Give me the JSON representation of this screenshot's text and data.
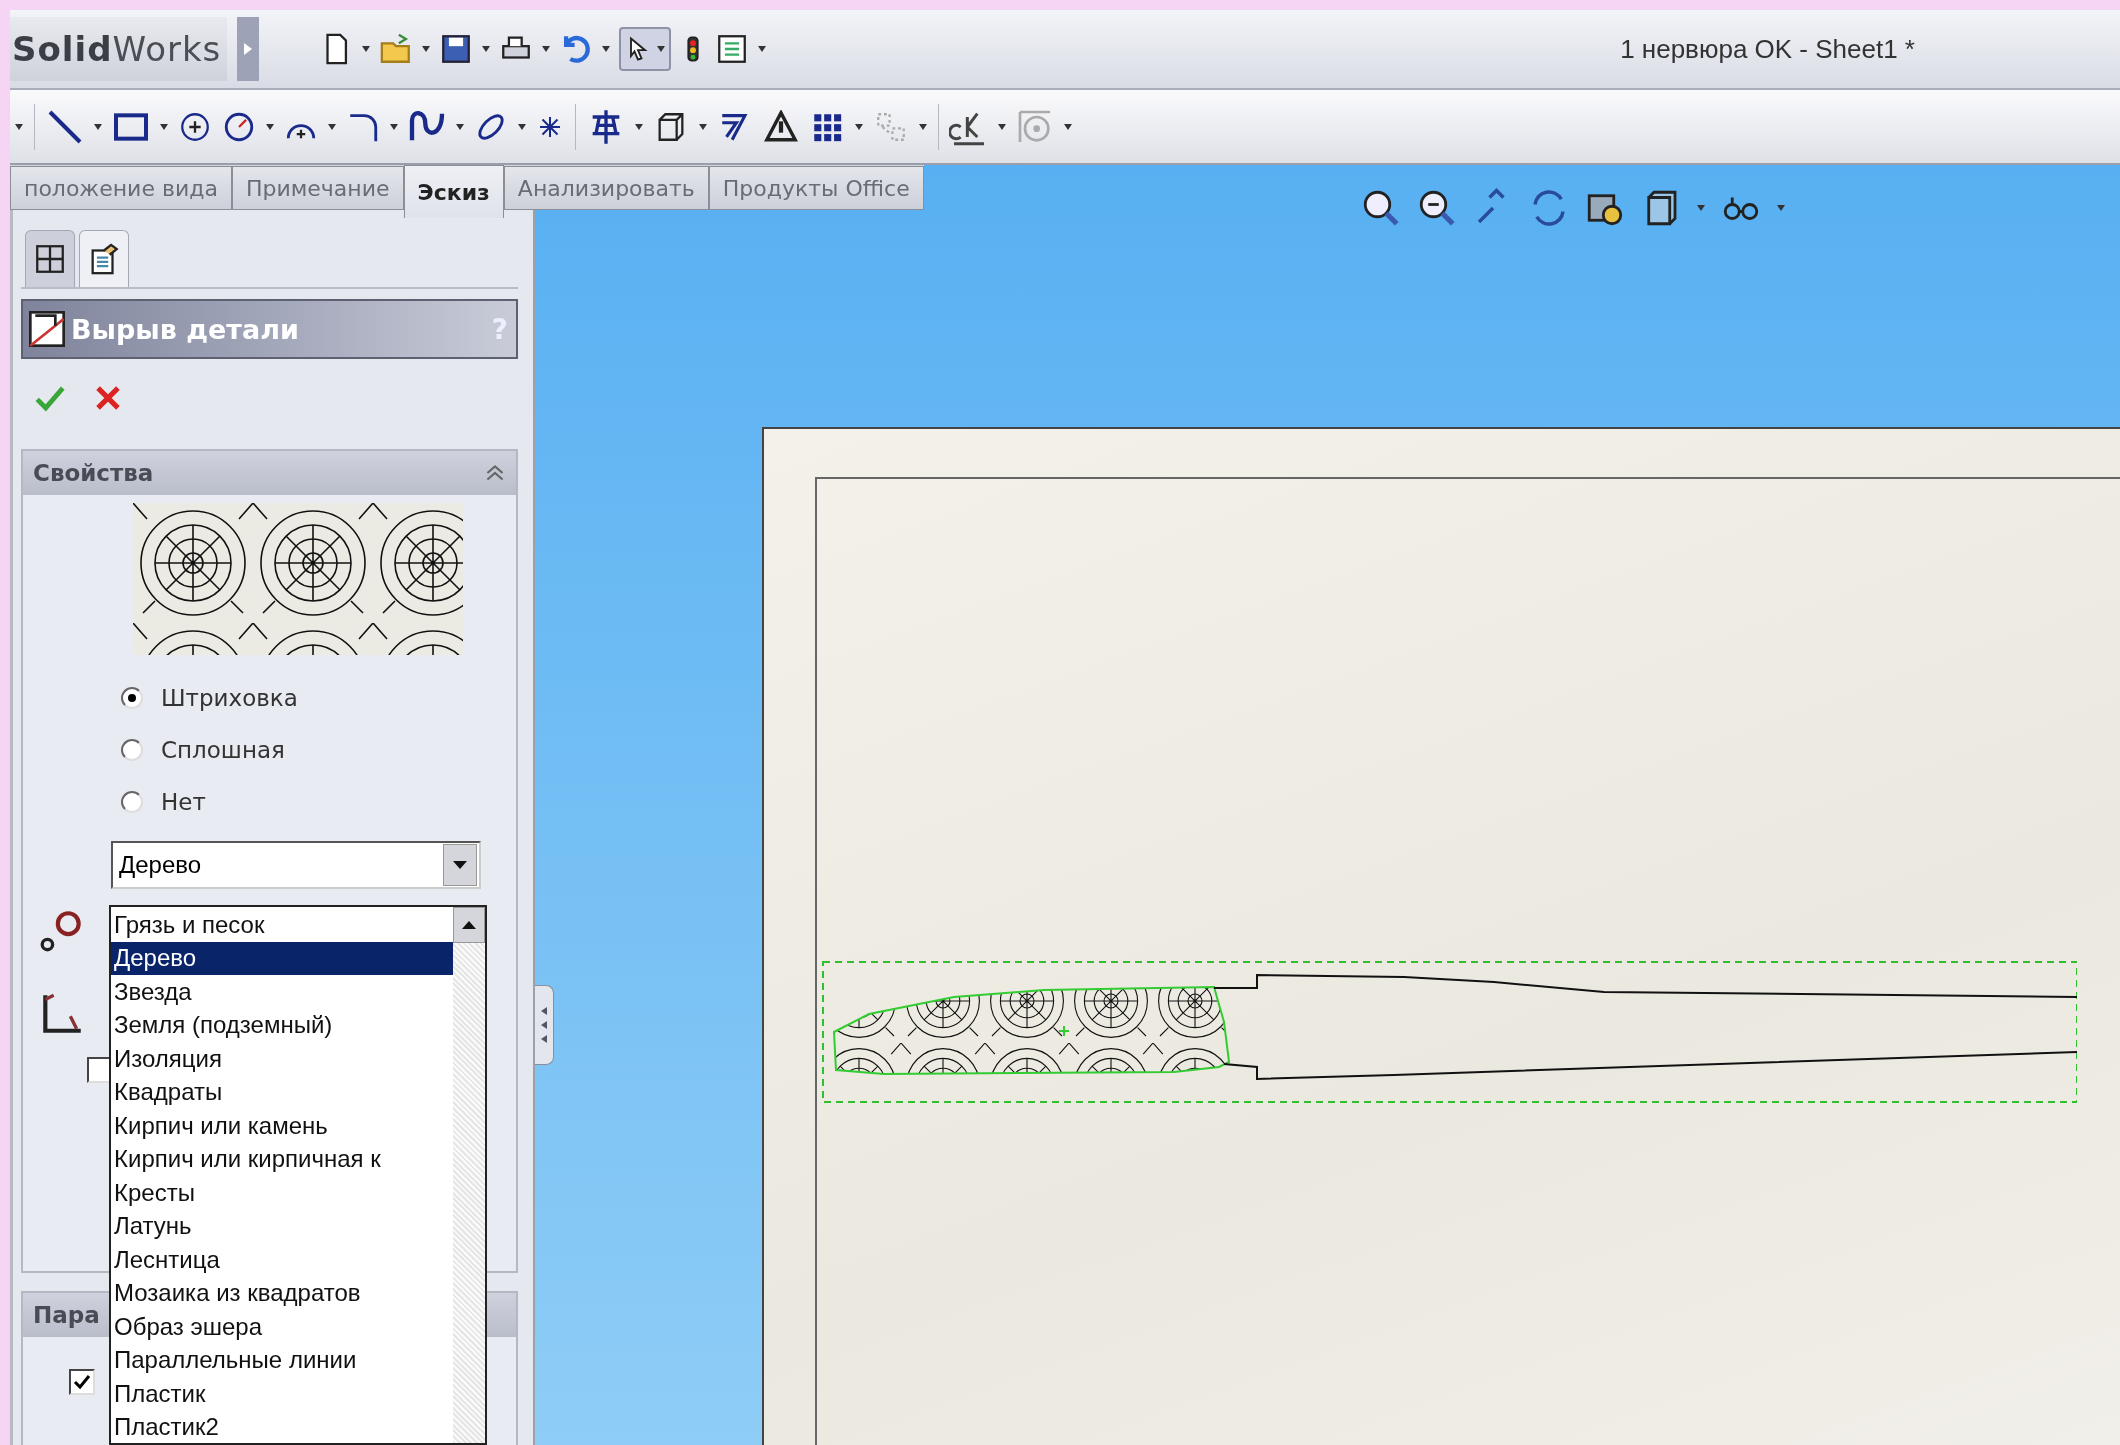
{
  "title_bar": {
    "logo": "**Solid**Works",
    "title": "1 нервюра OK - Sheet1 *"
  },
  "command_tabs": [
    {
      "label": "положение вида",
      "selected": false
    },
    {
      "label": "Примечание",
      "selected": false
    },
    {
      "label": "Эскиз",
      "selected": true
    },
    {
      "label": "Анализировать",
      "selected": false
    },
    {
      "label": "Продукты Office",
      "selected": false
    }
  ],
  "panel_tabs": [
    {
      "selected": false
    },
    {
      "selected": true
    }
  ],
  "property_panel": {
    "title": "Вырыв детали",
    "help": "?",
    "properties": {
      "header": "Свойства",
      "fill_options": [
        {
          "label": "Штриховка",
          "selected": true
        },
        {
          "label": "Сплошная",
          "selected": false
        },
        {
          "label": "Нет",
          "selected": false
        }
      ],
      "pattern": {
        "value": "Дерево"
      },
      "pattern_list": [
        {
          "label": "Грязь и песок",
          "selected": false
        },
        {
          "label": "Дерево",
          "selected": true
        },
        {
          "label": "Звезда",
          "selected": false
        },
        {
          "label": "Земля (подземный)",
          "selected": false
        },
        {
          "label": "Изоляция",
          "selected": false
        },
        {
          "label": "Квадраты",
          "selected": false
        },
        {
          "label": "Кирпич или камень",
          "selected": false
        },
        {
          "label": "Кирпич или кирпичная к",
          "selected": false
        },
        {
          "label": "Кресты",
          "selected": false
        },
        {
          "label": "Латунь",
          "selected": false
        },
        {
          "label": "Леснтица",
          "selected": false
        },
        {
          "label": "Мозаика из квадратов",
          "selected": false
        },
        {
          "label": "Образ эшера",
          "selected": false
        },
        {
          "label": "Параллельные линии",
          "selected": false
        },
        {
          "label": "Пластик",
          "selected": false
        },
        {
          "label": "Пластик2",
          "selected": false
        }
      ],
      "hidden_checkbox": {
        "checked": false
      }
    },
    "parameters": {
      "header": "Пара",
      "checkbox": {
        "checked": true
      }
    }
  }
}
